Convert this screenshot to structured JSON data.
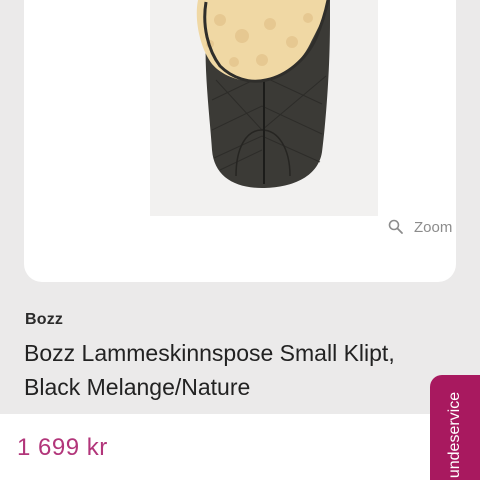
{
  "product": {
    "brand": "Bozz",
    "title": "Bozz Lammeskinnspose Small Klipt, Black Melange/Nature",
    "price": "1 699 kr",
    "image_alt": "footmuff-product-image"
  },
  "zoom": {
    "label": "Zoom",
    "icon": "search-icon"
  },
  "support": {
    "label": "undeservice"
  },
  "colors": {
    "accent": "#a8195f",
    "price": "#b2357a",
    "background": "#ebeaea"
  }
}
